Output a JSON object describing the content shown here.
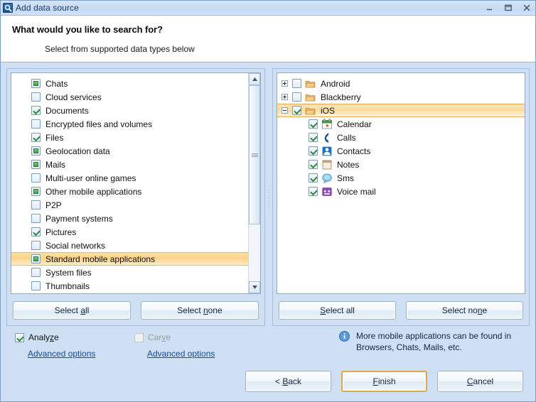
{
  "window": {
    "title": "Add data source",
    "icon": "magnifier-icon",
    "controls": {
      "minimize": "Minimize",
      "maximize": "Maximize",
      "close": "Close"
    }
  },
  "header": {
    "title": "What would you like to search for?",
    "subtitle": "Select from supported data types below"
  },
  "left_panel": {
    "items": [
      {
        "label": "Chats",
        "state": "filled",
        "selected": false
      },
      {
        "label": "Cloud services",
        "state": "unchecked",
        "selected": false
      },
      {
        "label": "Documents",
        "state": "checked",
        "selected": false
      },
      {
        "label": "Encrypted files and volumes",
        "state": "unchecked",
        "selected": false
      },
      {
        "label": "Files",
        "state": "checked",
        "selected": false
      },
      {
        "label": "Geolocation data",
        "state": "filled",
        "selected": false
      },
      {
        "label": "Mails",
        "state": "filled",
        "selected": false
      },
      {
        "label": "Multi-user online games",
        "state": "unchecked",
        "selected": false
      },
      {
        "label": "Other mobile applications",
        "state": "filled",
        "selected": false
      },
      {
        "label": "P2P",
        "state": "unchecked",
        "selected": false
      },
      {
        "label": "Payment systems",
        "state": "unchecked",
        "selected": false
      },
      {
        "label": "Pictures",
        "state": "checked",
        "selected": false
      },
      {
        "label": "Social networks",
        "state": "unchecked",
        "selected": false
      },
      {
        "label": "Standard mobile applications",
        "state": "filled",
        "selected": true
      },
      {
        "label": "System files",
        "state": "unchecked",
        "selected": false
      },
      {
        "label": "Thumbnails",
        "state": "unchecked",
        "selected": false
      }
    ],
    "select_all": {
      "pre": "Select ",
      "acc": "a",
      "post": "ll"
    },
    "select_none": {
      "pre": "Select ",
      "acc": "n",
      "post": "one"
    }
  },
  "right_panel": {
    "nodes": [
      {
        "label": "Android",
        "state": "unchecked",
        "expander": "plus",
        "icon": "folder-icon",
        "level": 0,
        "selected": false
      },
      {
        "label": "Blackberry",
        "state": "unchecked",
        "expander": "plus",
        "icon": "folder-icon",
        "level": 0,
        "selected": false
      },
      {
        "label": "iOS",
        "state": "checked",
        "expander": "minus",
        "icon": "folder-icon",
        "level": 0,
        "selected": true
      },
      {
        "label": "Calendar",
        "state": "checked",
        "expander": "none",
        "icon": "calendar-icon",
        "level": 1,
        "selected": false
      },
      {
        "label": "Calls",
        "state": "checked",
        "expander": "none",
        "icon": "phone-icon",
        "level": 1,
        "selected": false
      },
      {
        "label": "Contacts",
        "state": "checked",
        "expander": "none",
        "icon": "contact-icon",
        "level": 1,
        "selected": false
      },
      {
        "label": "Notes",
        "state": "checked",
        "expander": "none",
        "icon": "notes-icon",
        "level": 1,
        "selected": false
      },
      {
        "label": "Sms",
        "state": "checked",
        "expander": "none",
        "icon": "sms-icon",
        "level": 1,
        "selected": false
      },
      {
        "label": "Voice mail",
        "state": "checked",
        "expander": "none",
        "icon": "voicemail-icon",
        "level": 1,
        "selected": false
      }
    ],
    "select_all": {
      "pre": "",
      "acc": "S",
      "post": "elect all"
    },
    "select_none": {
      "pre": "Select no",
      "acc": "n",
      "post": "e"
    }
  },
  "options": {
    "analyze": {
      "pre": "Analy",
      "acc": "z",
      "post": "e",
      "checked": true,
      "enabled": true
    },
    "carve": {
      "pre": "Car",
      "acc": "v",
      "post": "e",
      "checked": false,
      "enabled": false
    },
    "advanced_left": "Advanced options",
    "advanced_right": "Advanced options",
    "info_icon": "info-icon",
    "info_line1": "More mobile applications can be found in",
    "info_line2": "Browsers, Chats, Mails, etc."
  },
  "footer": {
    "back": {
      "pre": "< ",
      "acc": "B",
      "post": "ack"
    },
    "finish": {
      "pre": "",
      "acc": "F",
      "post": "inish",
      "default": true
    },
    "cancel": {
      "pre": "",
      "acc": "C",
      "post": "ancel"
    }
  },
  "colors": {
    "body": "#cfdff4",
    "selection": "#fbd288",
    "default_button_border": "#d9a84f",
    "check_green": "#2e8b33",
    "link": "#1a4c86"
  }
}
